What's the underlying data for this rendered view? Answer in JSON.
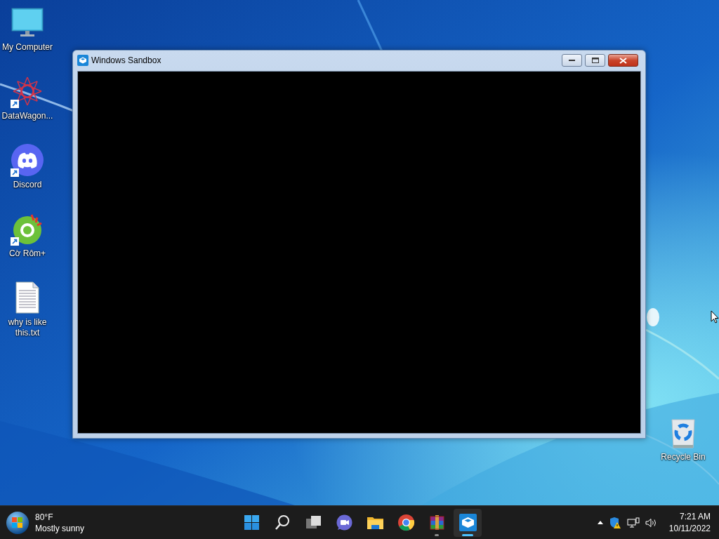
{
  "desktop_icons": [
    {
      "label": "My Computer",
      "shortcut": false
    },
    {
      "label": "DataWagon...",
      "shortcut": true
    },
    {
      "label": "Discord",
      "shortcut": true
    },
    {
      "label": "Cờ Rôm+",
      "shortcut": true
    },
    {
      "label": "why is like this.txt",
      "shortcut": false
    }
  ],
  "recycle_bin": {
    "label": "Recycle Bin"
  },
  "window": {
    "title": "Windows Sandbox"
  },
  "taskbar": {
    "weather": {
      "temperature": "80°F",
      "condition": "Mostly sunny"
    },
    "apps": [
      {
        "running": false,
        "selected": false
      },
      {
        "running": false,
        "selected": false
      },
      {
        "running": false,
        "selected": false
      },
      {
        "running": false,
        "selected": false
      },
      {
        "running": false,
        "selected": false
      },
      {
        "running": false,
        "selected": false
      },
      {
        "running": true,
        "selected": false
      },
      {
        "running": true,
        "selected": true
      }
    ],
    "clock": {
      "time": "7:21 AM",
      "date": "10/11/2022"
    }
  }
}
